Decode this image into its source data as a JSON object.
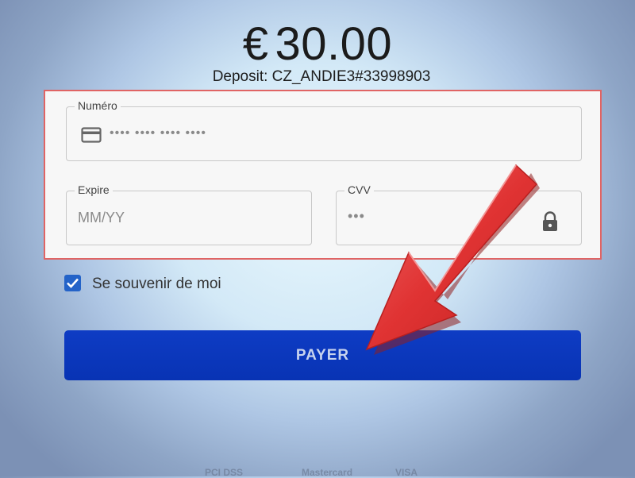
{
  "payment": {
    "currency_symbol": "€",
    "amount": "30.00",
    "deposit_label": "Deposit: CZ_ANDIE3#33998903"
  },
  "form": {
    "number": {
      "label": "Numéro",
      "placeholder": "•••• •••• •••• ••••",
      "icon": "credit-card-icon"
    },
    "expire": {
      "label": "Expire",
      "placeholder": "MM/YY"
    },
    "cvv": {
      "label": "CVV",
      "placeholder": "•••",
      "icon": "lock-icon"
    }
  },
  "remember_me": {
    "label": "Se souvenir de moi",
    "checked": true
  },
  "pay_button": {
    "label": "PAYER"
  },
  "footer_badges": [
    "PCI DSS",
    "Mastercard",
    "VISA"
  ],
  "colors": {
    "highlight_border": "#e06464",
    "button": "#0a38bc",
    "checkbox": "#2463c8",
    "arrow": "#e03a3a"
  }
}
